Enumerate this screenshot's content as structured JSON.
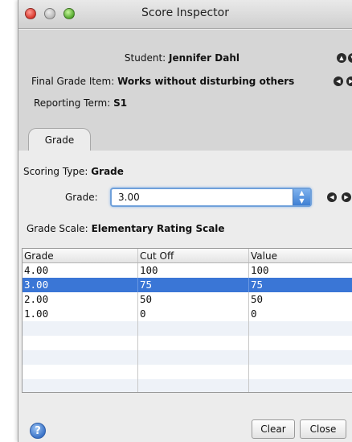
{
  "window": {
    "title": "Score Inspector"
  },
  "header": {
    "student_label": "Student:",
    "student_value": "Jennifer Dahl",
    "final_label": "Final Grade Item:",
    "final_value": "Works without disturbing others",
    "term_label": "Reporting Term:",
    "term_value": "S1"
  },
  "tabs": [
    {
      "label": "Grade"
    }
  ],
  "form": {
    "scoring_label": "Scoring Type:",
    "scoring_value": "Grade",
    "grade_label": "Grade:",
    "grade_value": "3.00",
    "scale_label": "Grade Scale:",
    "scale_value": "Elementary Rating Scale"
  },
  "table": {
    "headers": [
      "Grade",
      "Cut Off",
      "Value"
    ],
    "rows": [
      [
        "4.00",
        "100",
        "100"
      ],
      [
        "3.00",
        "75",
        "75"
      ],
      [
        "2.00",
        "50",
        "50"
      ],
      [
        "1.00",
        "0",
        "0"
      ]
    ],
    "selected_row": 1
  },
  "buttons": {
    "clear": "Clear",
    "close": "Close",
    "help": "?"
  },
  "icons": {
    "combo": "stepper-arrows-icon",
    "nav": [
      "up-arrow-icon",
      "down-arrow-icon",
      "left-arrow-icon",
      "right-arrow-icon"
    ]
  },
  "colors": {
    "selection": "#3a76d6",
    "focus_ring": "#6fa0da",
    "header_bg": "#d6d6d6"
  }
}
